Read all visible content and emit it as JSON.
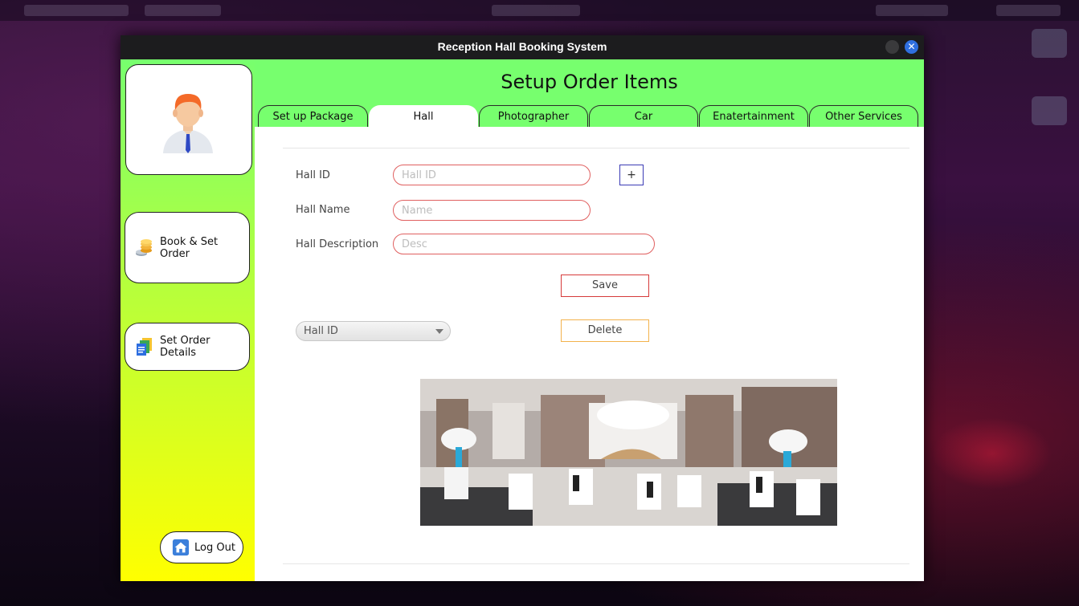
{
  "window": {
    "title": "Reception Hall Booking System",
    "close_glyph": "✕"
  },
  "sidebar": {
    "avatar_icon": "user-avatar-icon",
    "items": [
      {
        "label": "Book & Set Order",
        "icon": "coins-icon"
      },
      {
        "label": "Set Order Details",
        "icon": "documents-icon"
      }
    ],
    "logout": {
      "label": "Log Out",
      "icon": "home-icon"
    }
  },
  "header": {
    "title": "Setup Order Items"
  },
  "tabs": [
    {
      "label": "Set up Package",
      "active": false
    },
    {
      "label": "Hall",
      "active": true
    },
    {
      "label": "Photographer",
      "active": false
    },
    {
      "label": "Car",
      "active": false
    },
    {
      "label": "Enatertainment",
      "active": false
    },
    {
      "label": "Other Services",
      "active": false
    }
  ],
  "form": {
    "hall_id": {
      "label": "Hall ID",
      "placeholder": "Hall ID",
      "value": ""
    },
    "hall_name": {
      "label": "Hall Name",
      "placeholder": "Name",
      "value": ""
    },
    "hall_description": {
      "label": "Hall Description",
      "placeholder": "Desc",
      "value": ""
    },
    "add_button": "+",
    "save_button": "Save",
    "delete_button": "Delete",
    "hall_select": {
      "selected": "Hall ID"
    }
  },
  "colors": {
    "header_green": "#77ff6e",
    "sidebar_bottom": "#ffff00",
    "field_border": "#e06060",
    "save_border": "#d63a3a",
    "delete_border": "#f3b24c",
    "plus_border": "#3b3bb5"
  }
}
